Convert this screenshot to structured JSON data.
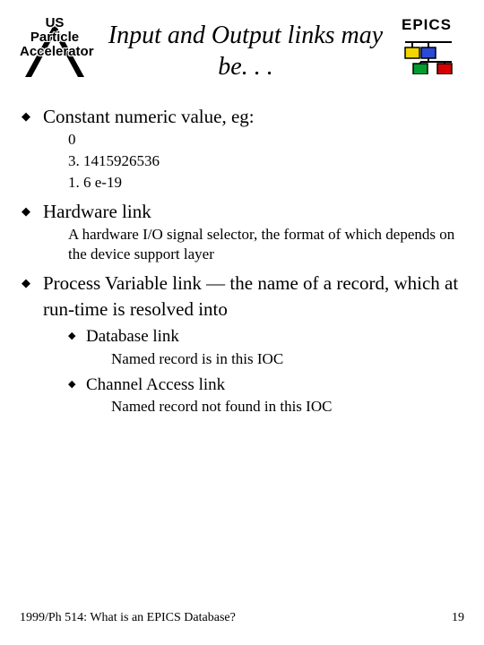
{
  "header": {
    "logo_left_line1": "US",
    "logo_left_line2": "Particle",
    "logo_left_line3": "Accelerator",
    "title": "Input and Output links may be. . .",
    "epics_label": "EPICS"
  },
  "bullets": [
    {
      "heading": "Constant numeric value, eg:",
      "examples": [
        "0",
        "3. 1415926536",
        "1. 6 e-19"
      ]
    },
    {
      "heading": "Hardware link",
      "description": "A hardware I/O signal selector, the format of which depends on the device support layer"
    },
    {
      "heading": "Process Variable link — the name of a record, which at run-time is resolved into",
      "sub_bullets": [
        {
          "label": "Database link",
          "detail": "Named record is in this IOC"
        },
        {
          "label": "Channel Access link",
          "detail": "Named record not found in this IOC"
        }
      ]
    }
  ],
  "footer": {
    "left": "1999/Ph 514: What is an EPICS Database?",
    "right": "19"
  },
  "colors": {
    "epics_yellow": "#f2d600",
    "epics_blue": "#2a4ad6",
    "epics_green": "#009e2e",
    "epics_red": "#d60000"
  }
}
